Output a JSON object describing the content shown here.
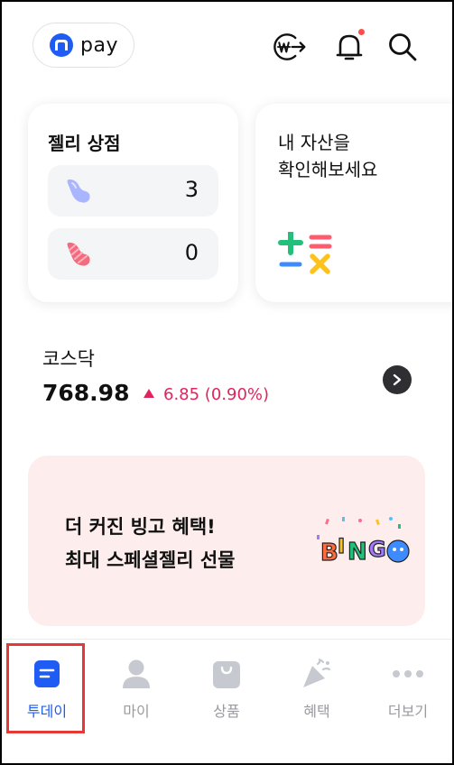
{
  "header": {
    "logo_text": "pay",
    "icons": [
      "kakao-logo-icon",
      "currency-exchange-icon",
      "bell-icon",
      "search-icon"
    ]
  },
  "jelly_store": {
    "title": "젤리 상점",
    "items": [
      {
        "icon": "blue-jelly-icon",
        "count": "3"
      },
      {
        "icon": "red-jelly-icon",
        "count": "0"
      }
    ]
  },
  "asset_card": {
    "title": "내 자산을\n확인해보세요",
    "icon": "calculator-icon"
  },
  "index": {
    "name": "코스닥",
    "value": "768.98",
    "change": "6.85 (0.90%)",
    "direction": "up",
    "up_color": "#e0245e"
  },
  "banner": {
    "line1": "더 커진 빙고 혜택!",
    "line2": "최대 스페셜젤리 선물",
    "background": "#fdeeed",
    "image": "bingo-icon"
  },
  "nav": {
    "items": [
      {
        "label": "투데이",
        "icon": "today-icon",
        "active": true
      },
      {
        "label": "마이",
        "icon": "person-icon",
        "active": false
      },
      {
        "label": "상품",
        "icon": "shopping-bag-icon",
        "active": false
      },
      {
        "label": "혜택",
        "icon": "party-popper-icon",
        "active": false
      },
      {
        "label": "더보기",
        "icon": "more-icon",
        "active": false
      }
    ],
    "accent": "#1e5cf3"
  }
}
